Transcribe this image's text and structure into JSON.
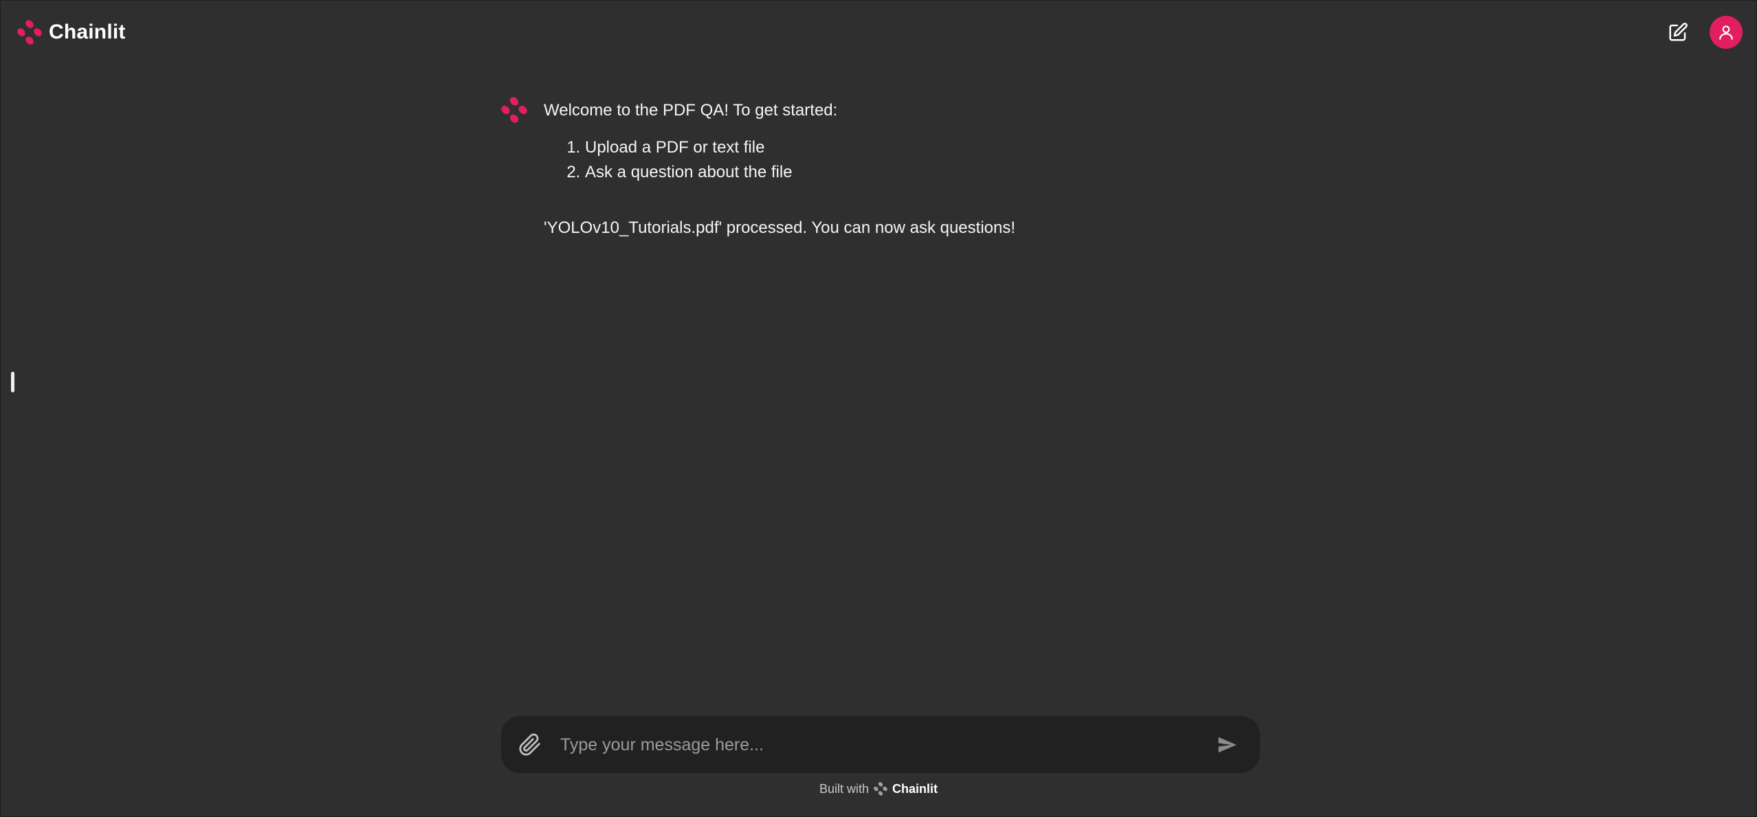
{
  "app": {
    "brand_name": "Chainlit",
    "brand_color": "#e11e62"
  },
  "header": {
    "new_chat_icon": "edit-icon",
    "avatar_icon": "user-icon"
  },
  "thread": {
    "messages": [
      {
        "author_icon": "chainlit-logo-icon",
        "intro": "Welcome to the PDF QA! To get started:",
        "steps": [
          "Upload a PDF or text file",
          "Ask a question about the file"
        ]
      },
      {
        "text": "'YOLOv10_Tutorials.pdf' processed. You can now ask questions!"
      }
    ]
  },
  "composer": {
    "placeholder": "Type your message here...",
    "value": "",
    "attach_icon": "paperclip-icon",
    "send_icon": "send-icon"
  },
  "footer": {
    "built_with": "Built with",
    "brand": "Chainlit"
  }
}
